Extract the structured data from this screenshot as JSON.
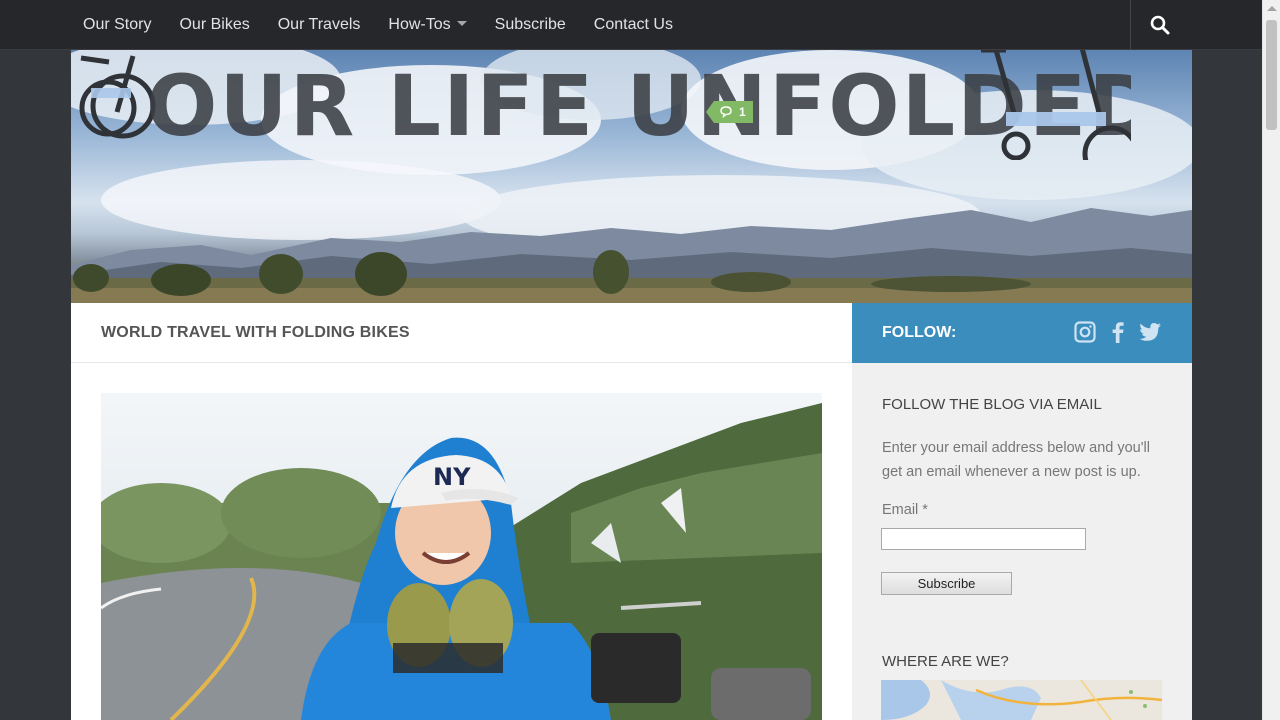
{
  "nav": {
    "items": [
      {
        "label": "Our Story"
      },
      {
        "label": "Our Bikes"
      },
      {
        "label": "Our Travels"
      },
      {
        "label": "How-Tos"
      },
      {
        "label": "Subscribe"
      },
      {
        "label": "Contact Us"
      }
    ],
    "search_icon": "search-icon"
  },
  "header": {
    "site_title": "OUR LIFE UNFOLDED"
  },
  "main": {
    "tagline": "WORLD TRAVEL WITH FOLDING BIKES",
    "featured_post": {
      "comment_count": "1",
      "comment_icon": "comments-icon"
    }
  },
  "sidebar": {
    "follow": {
      "label": "FOLLOW:",
      "icons": [
        "instagram-icon",
        "facebook-icon",
        "twitter-icon"
      ]
    },
    "email_widget": {
      "title": "FOLLOW THE BLOG VIA EMAIL",
      "description": "Enter your email address below and you'll get an email whenever a new post is up.",
      "email_label": "Email *",
      "email_value": "",
      "button_label": "Subscribe"
    },
    "map_widget": {
      "title": "WHERE ARE WE?"
    }
  },
  "colors": {
    "nav_bg": "#26272b",
    "page_bg": "#33363b",
    "follow_bar": "#3b8dbd",
    "comment_badge": "#82b965",
    "sidebar_bg": "#f0f0f0"
  }
}
